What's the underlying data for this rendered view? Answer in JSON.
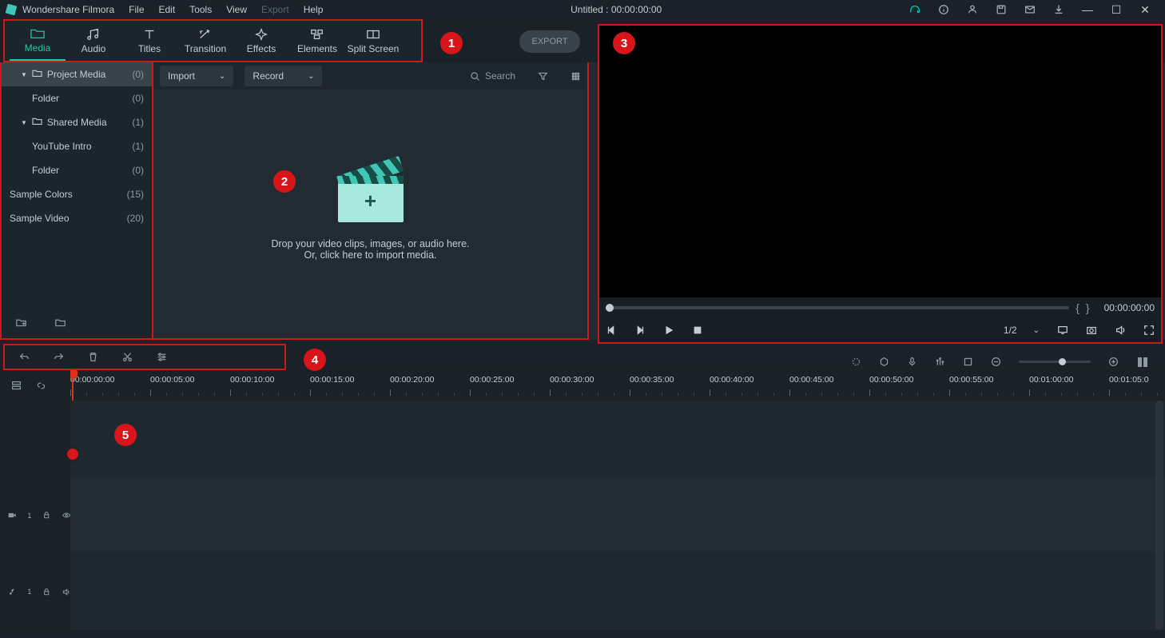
{
  "app": {
    "name": "Wondershare Filmora"
  },
  "menu": {
    "file": "File",
    "edit": "Edit",
    "tools": "Tools",
    "view": "View",
    "export": "Export",
    "help": "Help"
  },
  "title_center": "Untitled : 00:00:00:00",
  "tabs": {
    "media": "Media",
    "audio": "Audio",
    "titles": "Titles",
    "transition": "Transition",
    "effects": "Effects",
    "elements": "Elements",
    "split": "Split Screen"
  },
  "export_btn": "EXPORT",
  "sidebar": {
    "items": [
      {
        "label": "Project Media",
        "count": "(0)",
        "kind": "folder",
        "sel": true,
        "level": 0,
        "arrow": "▼"
      },
      {
        "label": "Folder",
        "count": "(0)",
        "kind": "plain",
        "level": 1
      },
      {
        "label": "Shared Media",
        "count": "(1)",
        "kind": "folder",
        "level": 0,
        "arrow": "▼"
      },
      {
        "label": "YouTube Intro",
        "count": "(1)",
        "kind": "plain",
        "level": 1
      },
      {
        "label": "Folder",
        "count": "(0)",
        "kind": "plain",
        "level": 1
      },
      {
        "label": "Sample Colors",
        "count": "(15)",
        "kind": "plain",
        "level": -1
      },
      {
        "label": "Sample Video",
        "count": "(20)",
        "kind": "plain",
        "level": -1
      }
    ]
  },
  "media_panel": {
    "import": "Import",
    "record": "Record",
    "search": "Search",
    "drop1": "Drop your video clips, images, or audio here.",
    "drop2": "Or, click here to import media."
  },
  "preview": {
    "mark_in": "{",
    "mark_out": "}",
    "time": "00:00:00:00",
    "ratio": "1/2"
  },
  "timeline": {
    "majors": [
      "00:00:00:00",
      "00:00:05:00",
      "00:00:10:00",
      "00:00:15:00",
      "00:00:20:00",
      "00:00:25:00",
      "00:00:30:00",
      "00:00:35:00",
      "00:00:40:00",
      "00:00:45:00",
      "00:00:50:00",
      "00:00:55:00",
      "00:01:00:00",
      "00:01:05:0"
    ]
  },
  "badges": {
    "b1": "1",
    "b2": "2",
    "b3": "3",
    "b4": "4",
    "b5": "5"
  }
}
